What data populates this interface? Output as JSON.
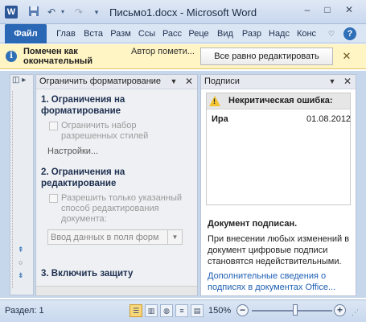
{
  "title": "Письмо1.docx - Microsoft Word",
  "quick_access": {
    "save_icon": "save-icon",
    "undo_icon": "undo-icon",
    "redo_icon": "redo-icon",
    "customize_icon": "chevron-down-icon"
  },
  "window_controls": {
    "minimize": "‒",
    "maximize": "□",
    "close": "✕"
  },
  "ribbon_tabs": [
    "Файл",
    "Глав",
    "Вста",
    "Разм",
    "Ссы",
    "Расс",
    "Реце",
    "Вид",
    "Разр",
    "Надс",
    "Конс"
  ],
  "message_bar": {
    "title": "Помечен как окончательный",
    "author": "Автор помети...",
    "edit_button": "Все равно редактировать",
    "close": "✕"
  },
  "restrict_pane": {
    "title": "Ограничить форматирование",
    "section1": "1. Ограничения на форматирование",
    "limit_styles": "Ограничить набор разрешенных стилей",
    "settings": "Настройки...",
    "section2": "2. Ограничения на редактирование",
    "allow_only": "Разрешить только указанный способ редактирования документа:",
    "edit_type": "Ввод данных в поля форм",
    "section3": "3. Включить защиту"
  },
  "signatures_pane": {
    "title": "Подписи",
    "warning": "Некритическая ошибка:",
    "signer": "Ира",
    "date": "01.08.2012",
    "signed_title": "Документ подписан.",
    "description": "При внесении любых изменений в документ цифровые подписи становятся недействительными.",
    "link": "Дополнительные сведения о подписях в документах Office..."
  },
  "status_bar": {
    "section": "Раздел: 1",
    "zoom": "150%",
    "zoom_level_percent": 150
  },
  "colors": {
    "file_tab": "#2a67b5",
    "message_bar": "#fff4c4",
    "link": "#1e5fb4",
    "warning": "#f2c230"
  }
}
